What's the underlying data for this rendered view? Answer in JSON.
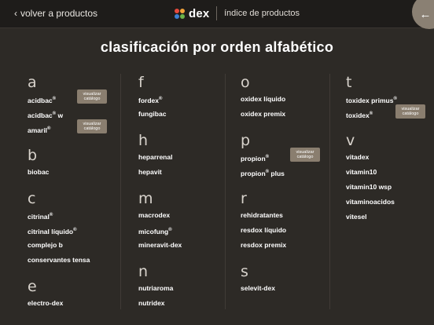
{
  "header": {
    "back_label": "volver a productos",
    "back_chevron": "‹",
    "brand_name": "dex",
    "index_title": "índice de productos",
    "arrow_icon": "←"
  },
  "page_title": "clasificación por orden alfabético",
  "badge_label_line1": "visualizar",
  "badge_label_line2": "catálogo",
  "columns": [
    [
      {
        "letter": "a",
        "items": [
          {
            "label": "acidbac",
            "reg": "®",
            "badge": true
          },
          {
            "label": "acidbac",
            "reg": "®",
            "suffix": " w"
          },
          {
            "label": "amaril",
            "reg": "®",
            "badge": true
          }
        ]
      },
      {
        "letter": "b",
        "items": [
          {
            "label": "biobac"
          }
        ]
      },
      {
        "letter": "c",
        "items": [
          {
            "label": "citrinal",
            "reg": "®"
          },
          {
            "label": "citrinal líquido",
            "reg": "®"
          },
          {
            "label": "complejo b"
          },
          {
            "label": "conservantes tensa"
          }
        ]
      },
      {
        "letter": "e",
        "items": [
          {
            "label": "electro-dex"
          }
        ]
      }
    ],
    [
      {
        "letter": "f",
        "items": [
          {
            "label": "fordex",
            "reg": "®"
          },
          {
            "label": "fungibac"
          }
        ]
      },
      {
        "letter": "h",
        "items": [
          {
            "label": "heparrenal"
          },
          {
            "label": "hepavit"
          }
        ]
      },
      {
        "letter": "m",
        "items": [
          {
            "label": "macrodex"
          },
          {
            "label": "micofung",
            "reg": "®"
          },
          {
            "label": "mineravit-dex"
          }
        ]
      },
      {
        "letter": "n",
        "items": [
          {
            "label": "nutriaroma"
          },
          {
            "label": "nutridex"
          }
        ]
      }
    ],
    [
      {
        "letter": "o",
        "items": [
          {
            "label": "oxidex líquido"
          },
          {
            "label": "oxidex premix"
          }
        ]
      },
      {
        "letter": "p",
        "items": [
          {
            "label": "propion",
            "reg": "®",
            "badge": true
          },
          {
            "label": "propion",
            "reg": "®",
            "suffix": " plus"
          }
        ]
      },
      {
        "letter": "r",
        "items": [
          {
            "label": "rehidratantes"
          },
          {
            "label": "resdox líquido"
          },
          {
            "label": "resdox premix"
          }
        ]
      },
      {
        "letter": "s",
        "items": [
          {
            "label": "selevit-dex"
          }
        ]
      }
    ],
    [
      {
        "letter": "t",
        "items": [
          {
            "label": "toxidex primus",
            "reg": "®"
          },
          {
            "label": "toxidex",
            "reg": "®",
            "badge": true
          }
        ]
      },
      {
        "letter": "v",
        "items": [
          {
            "label": "vitadex"
          },
          {
            "label": "vitamin10"
          },
          {
            "label": "vitamin10 wsp"
          },
          {
            "label": "vitaminoacidos"
          },
          {
            "label": "vitesel"
          }
        ]
      }
    ]
  ]
}
